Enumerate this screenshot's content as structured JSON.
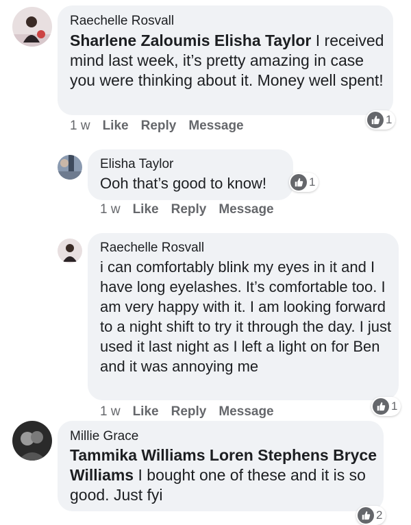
{
  "comments": [
    {
      "author": "Raechelle Rosvall",
      "mentions": "Sharlene Zaloumis Elisha Taylor",
      "text": " I received mind last week, it’s pretty amazing in case you were thinking about it. Money well spent!",
      "time": "1 w",
      "like": "Like",
      "reply": "Reply",
      "message": "Message",
      "reactions": "1"
    },
    {
      "author": "Elisha Taylor",
      "text": "Ooh that’s good to know!",
      "time": "1 w",
      "like": "Like",
      "reply": "Reply",
      "message": "Message",
      "reactions": "1"
    },
    {
      "author": "Raechelle Rosvall",
      "text": "i can comfortably blink my eyes in it and I have long eyelashes. It’s comfortable too. I am very happy with it. I am looking forward to a night shift to try it through the day. I just used it last night as I left a light on for Ben and it was annoying me",
      "time": "1 w",
      "like": "Like",
      "reply": "Reply",
      "message": "Message",
      "reactions": "1"
    },
    {
      "author": "Millie Grace",
      "mentions": "Tammika Williams Loren Stephens Bryce Williams",
      "text": " I bought one of these and it is so good. Just fyi",
      "reactions": "2"
    }
  ],
  "icons": {
    "reaction": "thumbs-up-icon"
  },
  "colors": {
    "bubble": "#f0f2f5",
    "reaction_badge": "#65676b",
    "meta_text": "#65676b"
  }
}
